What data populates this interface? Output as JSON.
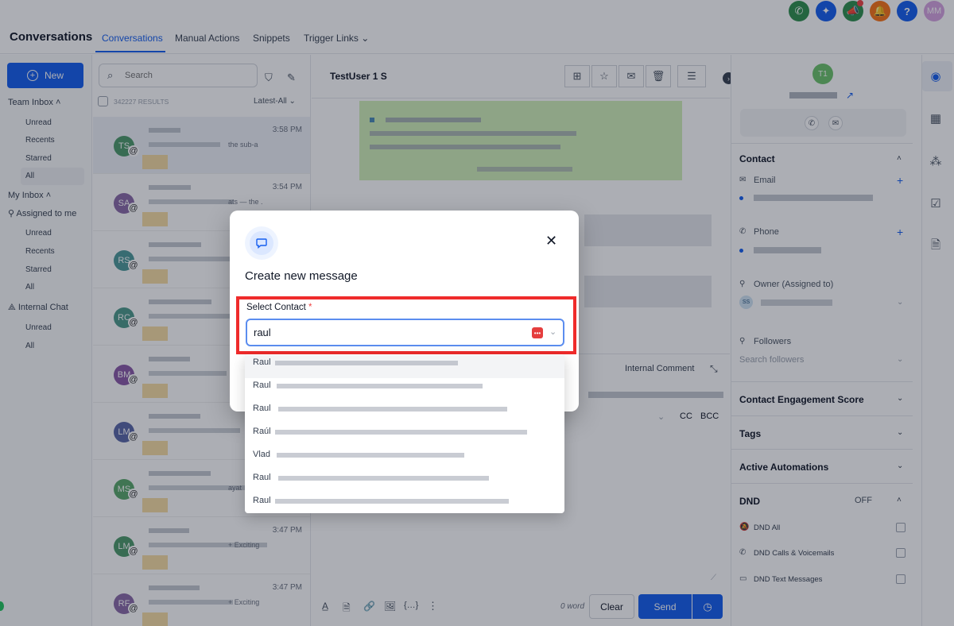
{
  "header": {
    "title": "Conversations",
    "tabs": [
      "Conversations",
      "Manual Actions",
      "Snippets",
      "Trigger Links"
    ],
    "user_initials": "MM"
  },
  "left_nav": {
    "new_label": "New",
    "team_inbox": "Team Inbox",
    "team_items": [
      "Unread",
      "Recents",
      "Starred",
      "All"
    ],
    "my_inbox": "My Inbox",
    "assigned_to_me": "Assigned to me",
    "my_items": [
      "Unread",
      "Recents",
      "Starred",
      "All"
    ],
    "internal_chat": "Internal Chat",
    "chat_items": [
      "Unread",
      "All"
    ]
  },
  "list": {
    "search_placeholder": "Search",
    "results": "342227 RESULTS",
    "sort": "Latest-All",
    "rows": [
      {
        "initials": "TS",
        "time": "3:58 PM",
        "snippet": "the sub-a",
        "color": "#4d9a6a"
      },
      {
        "initials": "SA",
        "time": "3:54 PM",
        "snippet": "ats — the .",
        "color": "#8a6aa8"
      },
      {
        "initials": "RS",
        "time": "",
        "snippet": "",
        "color": "#4d9a9a"
      },
      {
        "initials": "RC",
        "time": "",
        "snippet": "",
        "color": "#4d9a8a"
      },
      {
        "initials": "BM",
        "time": "",
        "snippet": "",
        "color": "#8a5aa8"
      },
      {
        "initials": "LM",
        "time": "",
        "snippet": "",
        "color": "#5a68a8"
      },
      {
        "initials": "MS",
        "time": "",
        "snippet": "ayat",
        "color": "#5aa86a"
      },
      {
        "initials": "LM",
        "time": "3:47 PM",
        "snippet": "+ Exciting",
        "color": "#4d9a6a"
      },
      {
        "initials": "RF",
        "time": "3:47 PM",
        "snippet": "+ Exciting",
        "color": "#8a6aa8"
      }
    ]
  },
  "conversation": {
    "contact_name": "TestUser 1 S",
    "internal_comment": "Internal Comment",
    "cc": "CC",
    "bcc": "BCC",
    "word_count": "0 word",
    "clear_label": "Clear",
    "send_label": "Send"
  },
  "right_panel": {
    "avatar_initials": "T1",
    "contact_section": "Contact",
    "email_label": "Email",
    "phone_label": "Phone",
    "owner_label": "Owner (Assigned to)",
    "owner_initials": "SS",
    "followers_label": "Followers",
    "followers_placeholder": "Search followers",
    "engagement": "Contact Engagement Score",
    "tags": "Tags",
    "automations": "Active Automations",
    "dnd": "DND",
    "dnd_state": "OFF",
    "dnd_all": "DND All",
    "dnd_calls": "DND Calls & Voicemails",
    "dnd_text": "DND Text Messages"
  },
  "modal": {
    "title": "Create new message",
    "field_label": "Select Contact",
    "required_mark": "*",
    "input_value": "raul",
    "options": [
      "Raul",
      "Raul",
      "Raul",
      "Raúl",
      "Vlad",
      "Raul",
      "Raul"
    ]
  }
}
